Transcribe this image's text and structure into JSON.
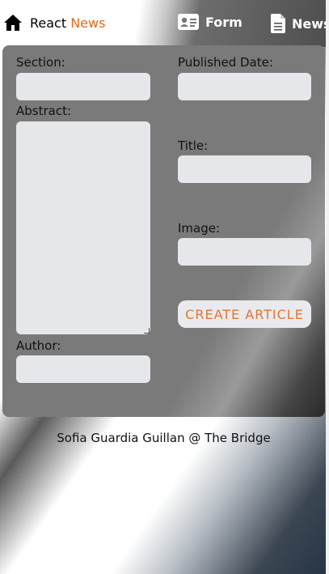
{
  "nav": {
    "brand_prefix": "React ",
    "brand_accent": "News",
    "form_link": "Form",
    "news_link": "News"
  },
  "form": {
    "section_label": "Section:",
    "published_date_label": "Published Date:",
    "abstract_label": "Abstract:",
    "title_label": "Title:",
    "image_label": "Image:",
    "author_label": "Author:",
    "create_button": "CREATE ARTICLE",
    "section_value": "",
    "published_date_value": "",
    "abstract_value": "",
    "title_value": "",
    "image_value": "",
    "author_value": ""
  },
  "footer": {
    "credit": "Sofia Guardia Guillan @ The Bridge"
  },
  "colors": {
    "accent": "#e0691d",
    "button_text": "#e27534",
    "field_bg": "#e6e7eb"
  }
}
